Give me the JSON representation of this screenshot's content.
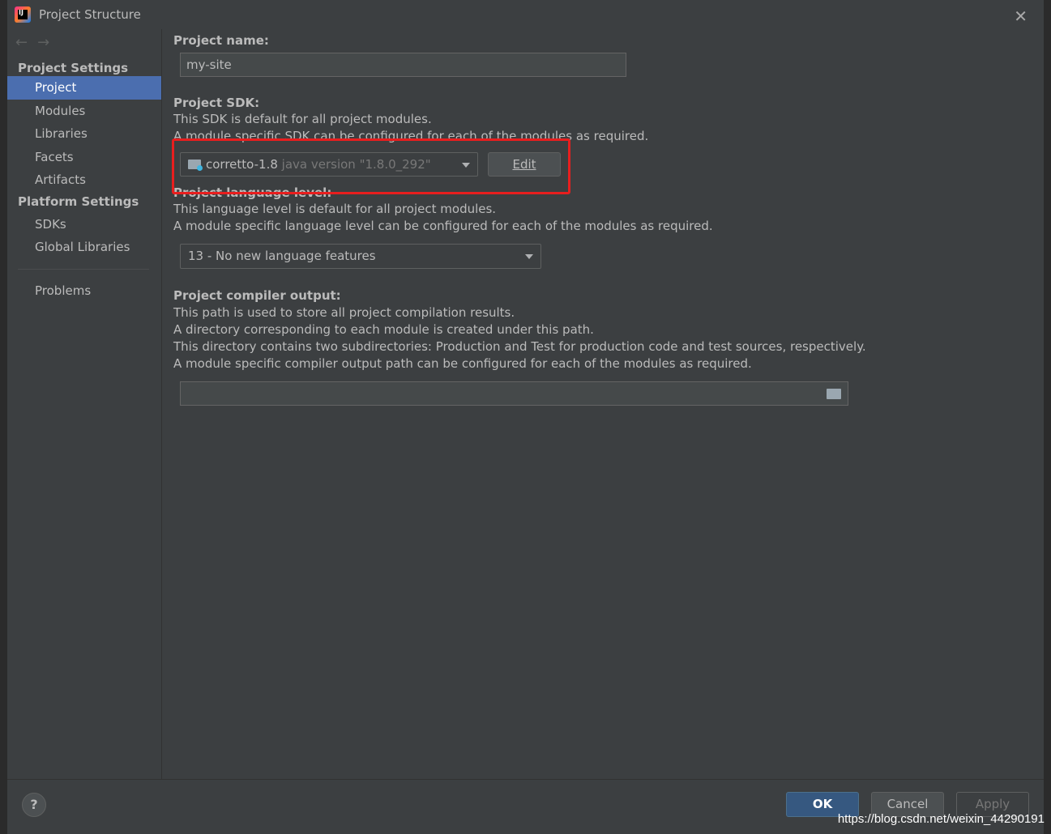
{
  "window": {
    "title": "Project Structure"
  },
  "sidebar": {
    "section1": "Project Settings",
    "items1": [
      "Project",
      "Modules",
      "Libraries",
      "Facets",
      "Artifacts"
    ],
    "section2": "Platform Settings",
    "items2": [
      "SDKs",
      "Global Libraries"
    ],
    "problems": "Problems"
  },
  "project_name": {
    "label": "Project name:",
    "value": "my-site"
  },
  "project_sdk": {
    "label": "Project SDK:",
    "desc1": "This SDK is default for all project modules.",
    "desc2": "A module specific SDK can be configured for each of the modules as required.",
    "sdk_name": "corretto-1.8",
    "sdk_version": "java version \"1.8.0_292\"",
    "edit_label": "Edit"
  },
  "language_level": {
    "label": "Project language level:",
    "desc1": "This language level is default for all project modules.",
    "desc2": "A module specific language level can be configured for each of the modules as required.",
    "value": "13 - No new language features"
  },
  "compiler_output": {
    "label": "Project compiler output:",
    "desc1": "This path is used to store all project compilation results.",
    "desc2": "A directory corresponding to each module is created under this path.",
    "desc3": "This directory contains two subdirectories: Production and Test for production code and test sources, respectively.",
    "desc4": "A module specific compiler output path can be configured for each of the modules as required.",
    "value": ""
  },
  "buttons": {
    "help": "?",
    "ok": "OK",
    "cancel": "Cancel",
    "apply": "Apply"
  },
  "watermark": "https://blog.csdn.net/weixin_44290191",
  "colors": {
    "selection": "#4b6eaf",
    "highlight": "#e81e1e",
    "primary": "#365880"
  }
}
